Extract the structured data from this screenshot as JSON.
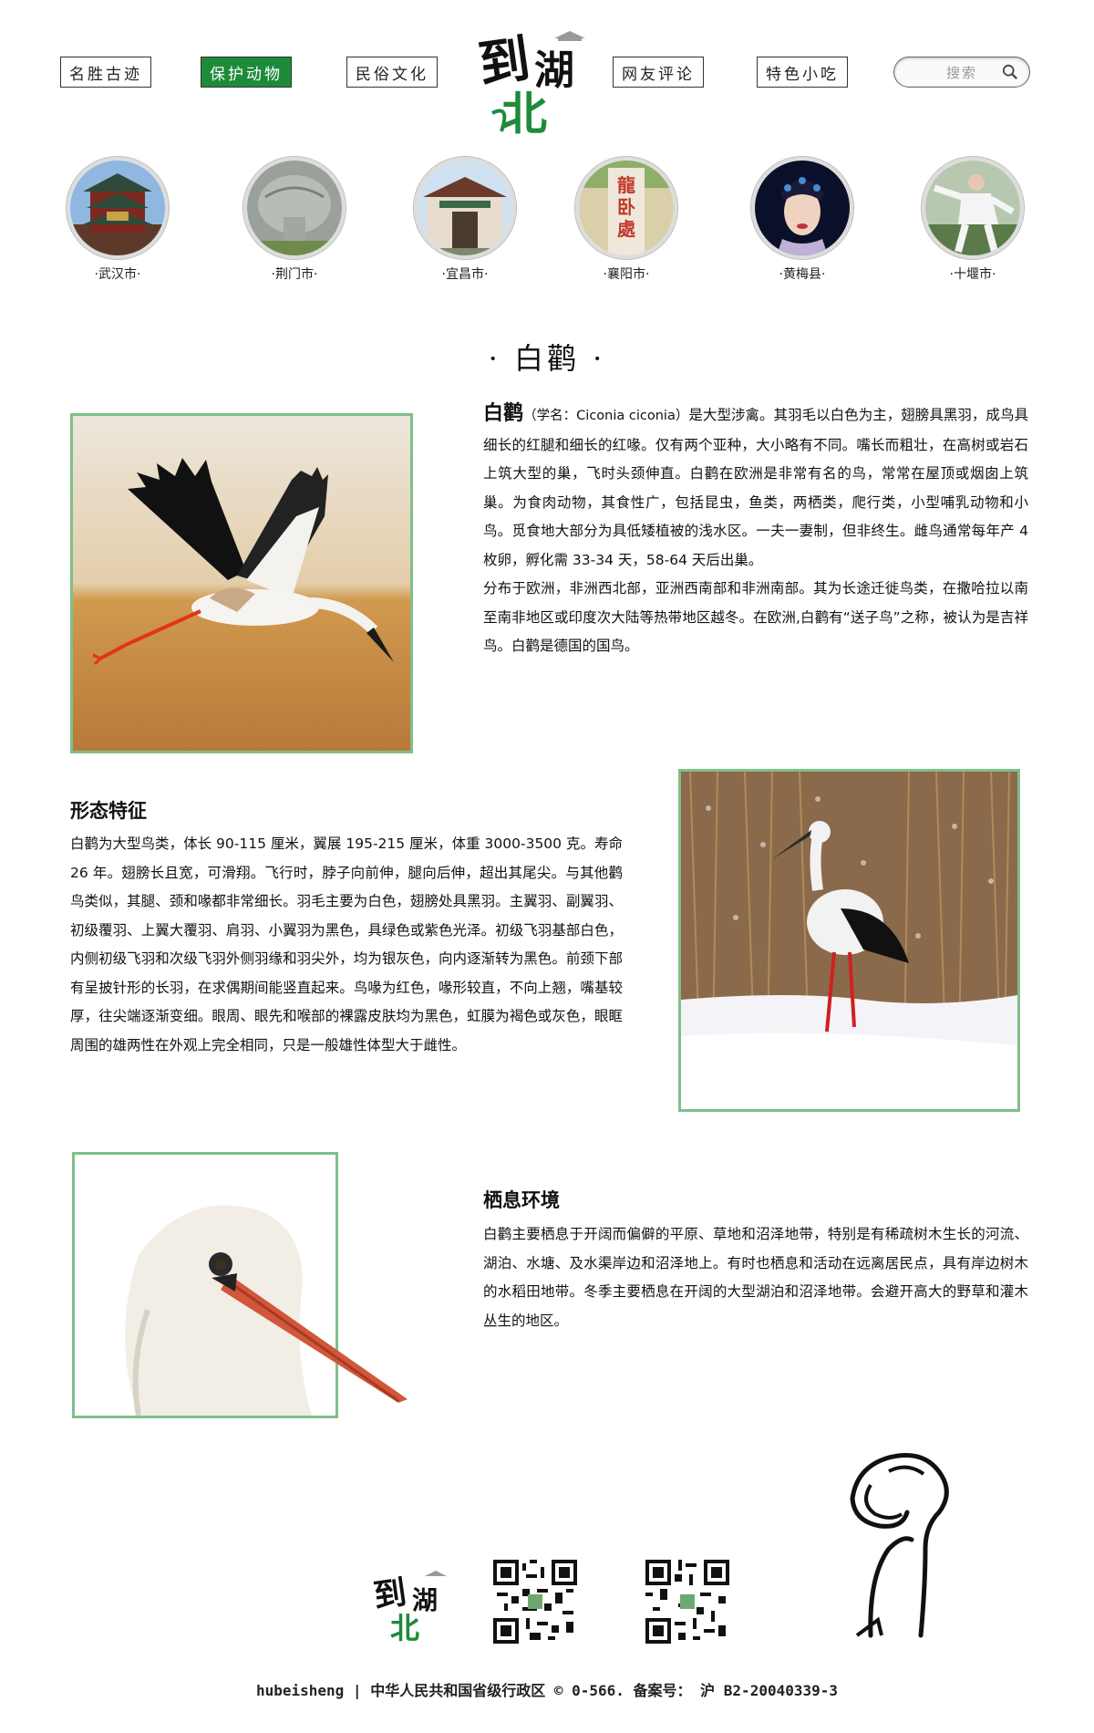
{
  "logo": {
    "text_top": "到湖",
    "text_bottom": "北"
  },
  "nav": {
    "items": [
      {
        "label": "名胜古迹"
      },
      {
        "label": "保护动物"
      },
      {
        "label": "民俗文化"
      },
      {
        "label": "网友评论"
      },
      {
        "label": "特色小吃"
      }
    ],
    "active_index": 1,
    "search_placeholder": "搜索"
  },
  "cities": [
    {
      "label": "·武汉市·"
    },
    {
      "label": "·荆门市·"
    },
    {
      "label": "·宜昌市·"
    },
    {
      "label": "·襄阳市·"
    },
    {
      "label": "·黄梅县·"
    },
    {
      "label": "·十堰市·"
    }
  ],
  "article": {
    "title": "· 白鹳 ·",
    "intro": {
      "name": "白鹳",
      "sci": "（学名：Ciconia ciconia）",
      "text1": "是大型涉禽。其羽毛以白色为主，翅膀具黑羽，成鸟具细长的红腿和细长的红喙。仅有两个亚种，大小略有不同。嘴长而粗壮，在高树或岩石上筑大型的巢，飞时头颈伸直。白鹳在欧洲是非常有名的鸟，常常在屋顶或烟囱上筑巢。为食肉动物，其食性广，包括昆虫，鱼类，两栖类，爬行类，小型哺乳动物和小鸟。觅食地大部分为具低矮植被的浅水区。一夫一妻制，但非终生。雌鸟通常每年产 4 枚卵，孵化需 33-34 天，58-64 天后出巢。",
      "text2": "分布于欧洲，非洲西北部，亚洲西南部和非洲南部。其为长途迁徙鸟类，在撒哈拉以南至南非地区或印度次大陆等热带地区越冬。在欧洲,白鹳有“送子鸟”之称，被认为是吉祥鸟。白鹳是德国的国鸟。"
    },
    "morphology": {
      "heading": "形态特征",
      "text": "白鹳为大型鸟类，体长 90-115 厘米，翼展 195-215 厘米，体重 3000-3500 克。寿命 26 年。翅膀长且宽，可滑翔。飞行时，脖子向前伸，腿向后伸，超出其尾尖。与其他鹳鸟类似，其腿、颈和喙都非常细长。羽毛主要为白色，翅膀处具黑羽。主翼羽、副翼羽、初级覆羽、上翼大覆羽、肩羽、小翼羽为黑色，具绿色或紫色光泽。初级飞羽基部白色，内侧初级飞羽和次级飞羽外侧羽缘和羽尖外，均为银灰色，向内逐渐转为黑色。前颈下部有呈披针形的长羽，在求偶期间能竖直起来。鸟喙为红色，喙形较直，不向上翘，嘴基较厚，往尖端逐渐变细。眼周、眼先和喉部的裸露皮肤均为黑色，虹膜为褐色或灰色，眼眶周围的雄两性在外观上完全相同，只是一般雄性体型大于雌性。"
    },
    "habitat": {
      "heading": "栖息环境",
      "text": "白鹳主要栖息于开阔而偏僻的平原、草地和沼泽地带，特别是有稀疏树木生长的河流、湖泊、水塘、及水渠岸边和沼泽地上。有时也栖息和活动在远离居民点，具有岸边树木的水稻田地带。冬季主要栖息在开阔的大型湖泊和沼泽地带。会避开高大的野草和灌木丛生的地区。"
    }
  },
  "footer": {
    "text": "hubeisheng | 中华人民共和国省级行政区 © 0-566. 备案号： 沪 B2-20040339-3"
  },
  "colors": {
    "accent_green": "#1e8a3a",
    "frame_green": "#7fbf8a"
  }
}
